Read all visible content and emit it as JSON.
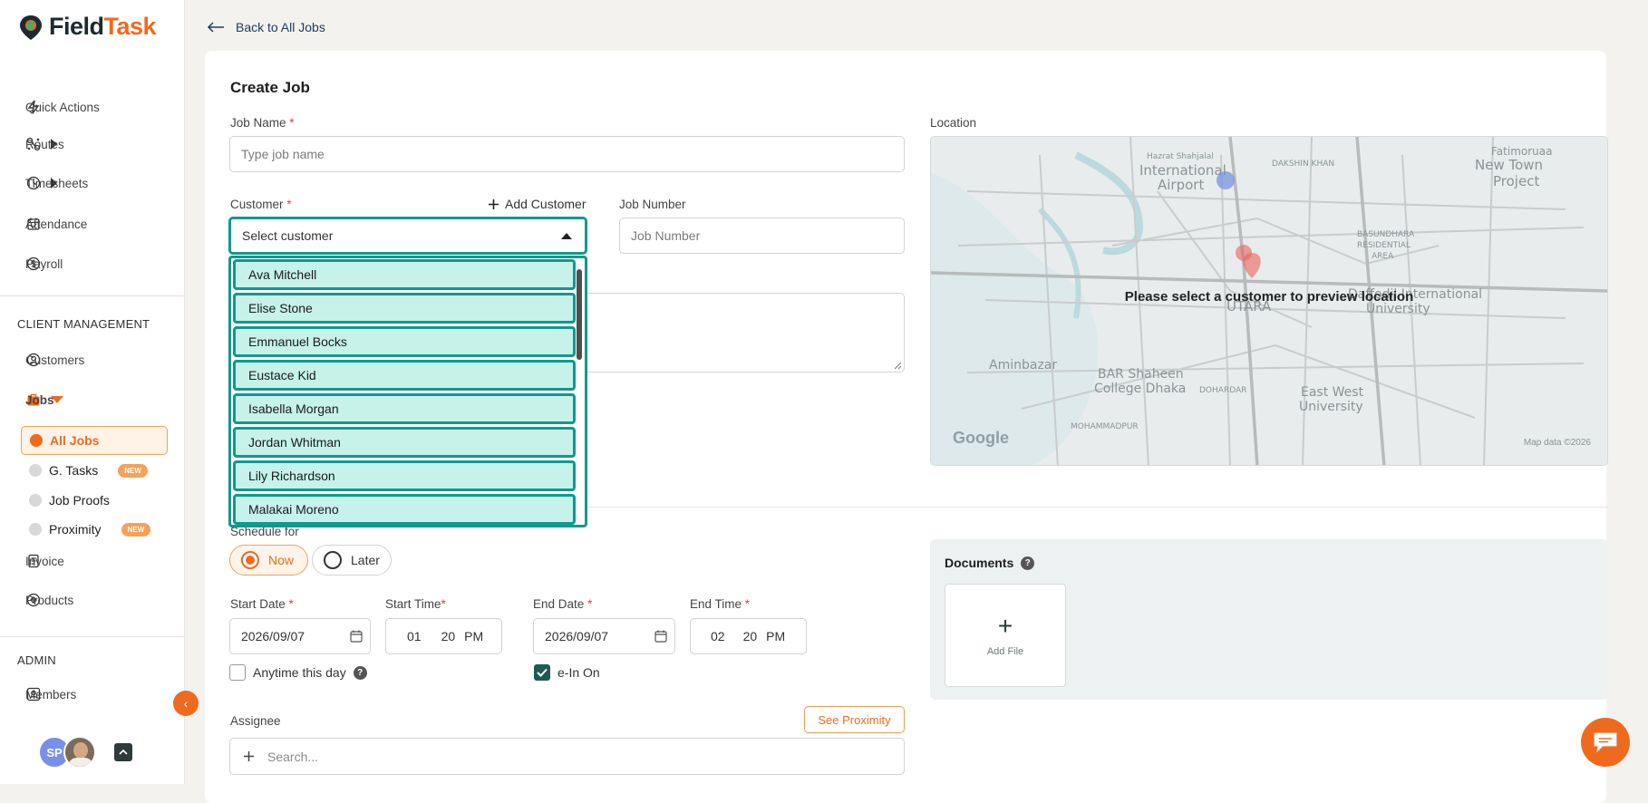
{
  "app": {
    "logo_prefix": "Field",
    "logo_suffix": "Task"
  },
  "sidebar": {
    "nav": [
      {
        "label": "Quick Actions",
        "icon": "bolt-icon"
      },
      {
        "label": "Routes",
        "icon": "route-icon"
      },
      {
        "label": "Timesheets",
        "icon": "clock-icon"
      },
      {
        "label": "Attendance",
        "icon": "calendar-icon"
      },
      {
        "label": "Payroll",
        "icon": "payroll-icon"
      }
    ],
    "client_management_heading": "CLIENT MANAGEMENT",
    "customers_label": "Customers",
    "jobs_label": "Jobs",
    "jobs_sub": [
      {
        "label": "All Jobs"
      },
      {
        "label": "G. Tasks",
        "badge": "NEW"
      },
      {
        "label": "Job Proofs"
      },
      {
        "label": "Proximity",
        "badge": "NEW"
      }
    ],
    "invoice_label": "Invoice",
    "products_label": "Products",
    "admin_heading": "ADMIN",
    "members_label": "Members",
    "user_initials": "SP"
  },
  "header": {
    "back_label": "Back to All Jobs"
  },
  "form": {
    "title": "Create Job",
    "job_name_label": "Job Name",
    "job_name_placeholder": "Type job name",
    "customer_label": "Customer",
    "add_customer_label": "Add Customer",
    "customer_select_value": "Select customer",
    "customer_options": [
      "Ava Mitchell",
      "Elise Stone",
      "Emmanuel Bocks",
      "Eustace Kid",
      "Isabella Morgan",
      "Jordan Whitman",
      "Lily Richardson",
      "Malakai Moreno"
    ],
    "job_number_label": "Job Number",
    "job_number_placeholder": "Job Number",
    "location_label": "Location",
    "map_message": "Please select a customer to preview location",
    "map_google": "Google",
    "map_attribution": "Map data ©2026",
    "map_places": [
      "Hazrat Shahjalal",
      "International",
      "Airport",
      "New Town",
      "Project",
      "Fatimoruaa",
      "DAKSHIN KHAN",
      "BASUNDHARA",
      "RESIDENTIAL",
      "AREA",
      "UTARA",
      "Daffodil International",
      "University",
      "Aminbazar",
      "BAR Shaheen",
      "College Dhaka",
      "East West",
      "University",
      "MOHAMMADPUR",
      "DOHARDAR"
    ],
    "schedule_label": "Schedule for",
    "schedule_now": "Now",
    "schedule_later": "Later",
    "start_date_label": "Start Date",
    "start_date_value": "2026/09/07",
    "start_time_label": "Start Time",
    "start_time": {
      "hour": "01",
      "minute": "20",
      "ampm": "PM"
    },
    "end_date_label": "End Date",
    "end_date_value": "2026/09/07",
    "end_time_label": "End Time",
    "end_time": {
      "hour": "02",
      "minute": "20",
      "ampm": "PM"
    },
    "anytime_label": "Anytime this day",
    "checkin_label": "e-In On",
    "assignee_label": "Assignee",
    "see_proximity_label": "See Proximity",
    "assignee_placeholder": "Search...",
    "documents_title": "Documents",
    "add_file_label": "Add File"
  },
  "colors": {
    "brand_orange": "#f06a1e",
    "teal": "#11998e",
    "teal_light": "#c6f2ea",
    "dark": "#1e2a30"
  }
}
